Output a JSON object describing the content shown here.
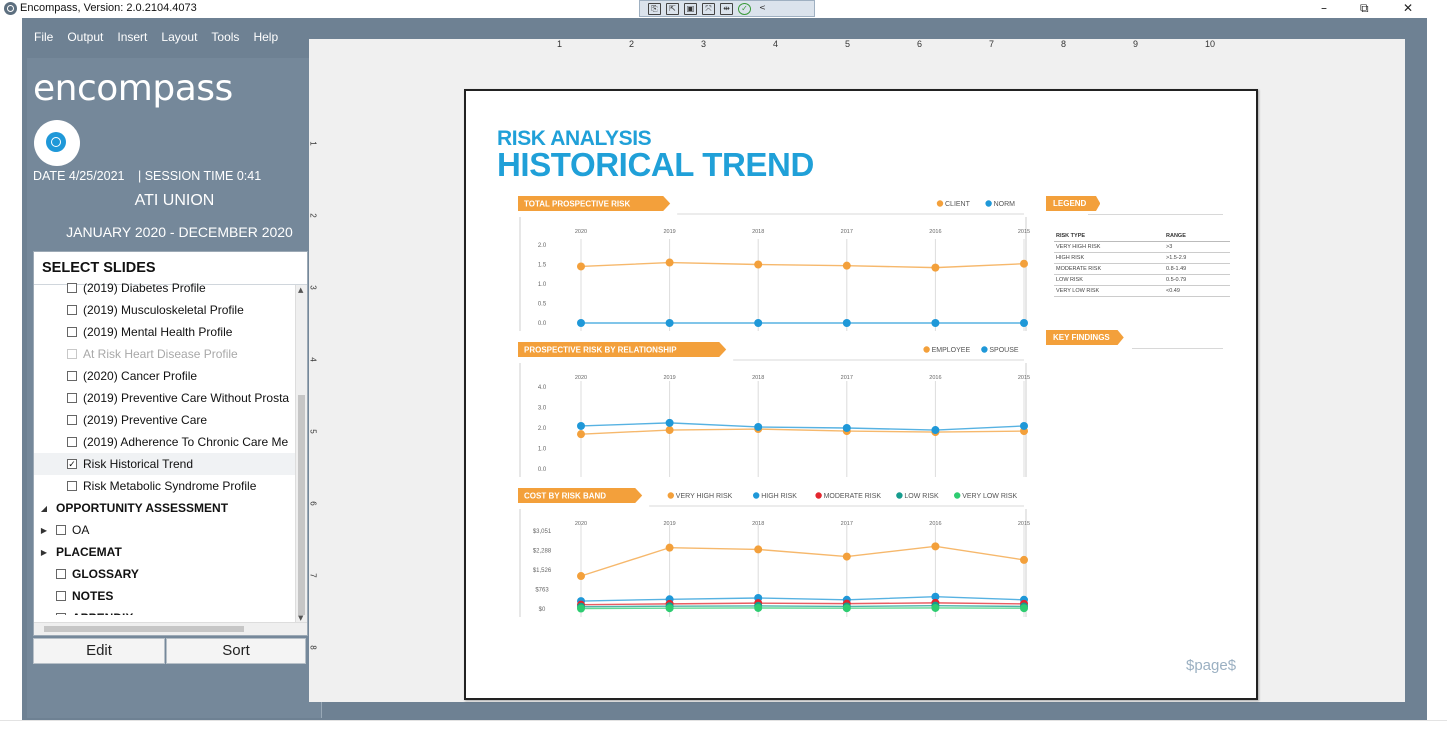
{
  "window": {
    "title": "Encompass, Version: 2.0.2104.4073",
    "controls": {
      "minimize": "–",
      "restore": "⧉",
      "close": "✕"
    }
  },
  "quick_tools": [
    "⎘",
    "⇱",
    "▣",
    "⤧",
    "⇹",
    "✓",
    "<"
  ],
  "menu": [
    "File",
    "Output",
    "Insert",
    "Layout",
    "Tools",
    "Help"
  ],
  "sidebar": {
    "logo": "encompass",
    "date": "DATE  4/25/2021",
    "session": "|  SESSION TIME    0:41",
    "client": "ATI UNION",
    "range": "JANUARY 2020 - DECEMBER 2020",
    "select_header": "SELECT SLIDES",
    "rows": [
      {
        "label": "(2019) Diabetes Profile",
        "indent": 1,
        "check": "empty"
      },
      {
        "label": "(2019) Musculoskeletal Profile",
        "indent": 1,
        "check": "empty"
      },
      {
        "label": "(2019) Mental Health Profile",
        "indent": 1,
        "check": "empty"
      },
      {
        "label": "At Risk Heart Disease Profile",
        "indent": 1,
        "check": "disabled"
      },
      {
        "label": "(2020) Cancer Profile",
        "indent": 1,
        "check": "empty"
      },
      {
        "label": "(2019) Preventive Care Without Prosta",
        "indent": 1,
        "check": "empty"
      },
      {
        "label": "(2019) Preventive Care",
        "indent": 1,
        "check": "empty"
      },
      {
        "label": "(2019) Adherence To Chronic Care Me",
        "indent": 1,
        "check": "empty"
      },
      {
        "label": "Risk Historical Trend",
        "indent": 1,
        "check": "checked"
      },
      {
        "label": "Risk Metabolic Syndrome Profile",
        "indent": 1,
        "check": "empty"
      },
      {
        "label": "OPPORTUNITY ASSESSMENT",
        "indent": 0,
        "check": "none",
        "expander": "◢",
        "bold": true
      },
      {
        "label": "OA",
        "indent": 0,
        "check": "empty",
        "expander": "▶"
      },
      {
        "label": "PLACEMAT",
        "indent": 0,
        "check": "none",
        "expander": "▶",
        "bold": true
      },
      {
        "label": "GLOSSARY",
        "indent": 0,
        "check": "empty",
        "bold": true
      },
      {
        "label": "NOTES",
        "indent": 0,
        "check": "empty",
        "bold": true
      },
      {
        "label": "APPENDIX",
        "indent": 0,
        "check": "empty",
        "bold": true
      }
    ],
    "edit_label": "Edit",
    "sort_label": "Sort"
  },
  "ruler": {
    "horizontal": [
      "1",
      "2",
      "3",
      "4",
      "5",
      "6",
      "7",
      "8",
      "9",
      "10"
    ],
    "vertical": [
      "1",
      "2",
      "3",
      "4",
      "5",
      "6",
      "7",
      "8"
    ]
  },
  "slide": {
    "subtitle": "RISK ANALYSIS",
    "title": "HISTORICAL TREND",
    "page_token": "$page$",
    "legend_tag": "LEGEND",
    "findings_tag": "KEY FINDINGS",
    "legend_head": {
      "type": "RISK TYPE",
      "range": "RANGE"
    },
    "legend_rows": [
      {
        "type": "VERY HIGH RISK",
        "range": ">3"
      },
      {
        "type": "HIGH RISK",
        "range": ">1.5-2.9"
      },
      {
        "type": "MODERATE RISK",
        "range": "0.8-1.49"
      },
      {
        "type": "LOW RISK",
        "range": "0.5-0.79"
      },
      {
        "type": "VERY LOW RISK",
        "range": "<0.49"
      }
    ]
  },
  "colors": {
    "orange": "#f3a03b",
    "blue": "#1f98d8",
    "red": "#e3262e",
    "teal": "#169c8e",
    "green": "#2ecc71",
    "title_blue": "#20a0d8"
  },
  "chart_data": [
    {
      "type": "line",
      "title": "TOTAL PROSPECTIVE RISK",
      "x": [
        "2020",
        "2019",
        "2018",
        "2017",
        "2016",
        "2015"
      ],
      "ylim": [
        0,
        2
      ],
      "yticks": [
        "2.0",
        "1.5",
        "1.0",
        "0.5",
        "0.0"
      ],
      "series": [
        {
          "name": "CLIENT",
          "color": "#f3a03b",
          "values": [
            1.45,
            1.55,
            1.5,
            1.47,
            1.42,
            1.52
          ]
        },
        {
          "name": "NORM",
          "color": "#1f98d8",
          "values": [
            0,
            0,
            0,
            0,
            0,
            0
          ]
        }
      ]
    },
    {
      "type": "line",
      "title": "PROSPECTIVE RISK BY RELATIONSHIP",
      "x": [
        "2020",
        "2019",
        "2018",
        "2017",
        "2016",
        "2015"
      ],
      "ylim": [
        0,
        4
      ],
      "yticks": [
        "4.0",
        "3.0",
        "2.0",
        "1.0",
        "0.0"
      ],
      "series": [
        {
          "name": "EMPLOYEE",
          "color": "#f3a03b",
          "values": [
            1.7,
            1.9,
            1.95,
            1.85,
            1.8,
            1.85
          ]
        },
        {
          "name": "SPOUSE",
          "color": "#1f98d8",
          "values": [
            2.1,
            2.25,
            2.05,
            2.0,
            1.9,
            2.1
          ]
        }
      ]
    },
    {
      "type": "line",
      "title": "COST BY RISK BAND",
      "x": [
        "2020",
        "2019",
        "2018",
        "2017",
        "2016",
        "2015"
      ],
      "ylim": [
        0,
        3051
      ],
      "yticks": [
        "$3,051",
        "$2,288",
        "$1,526",
        "$763",
        "$0"
      ],
      "series": [
        {
          "name": "VERY HIGH RISK",
          "color": "#f3a03b",
          "values": [
            1290,
            2400,
            2330,
            2050,
            2450,
            1920
          ]
        },
        {
          "name": "HIGH RISK",
          "color": "#1f98d8",
          "values": [
            310,
            380,
            430,
            360,
            480,
            360
          ]
        },
        {
          "name": "MODERATE RISK",
          "color": "#e3262e",
          "values": [
            170,
            200,
            230,
            210,
            240,
            200
          ]
        },
        {
          "name": "LOW RISK",
          "color": "#169c8e",
          "values": [
            90,
            110,
            120,
            100,
            130,
            100
          ]
        },
        {
          "name": "VERY LOW RISK",
          "color": "#2ecc71",
          "values": [
            20,
            30,
            40,
            30,
            40,
            30
          ]
        }
      ]
    }
  ]
}
